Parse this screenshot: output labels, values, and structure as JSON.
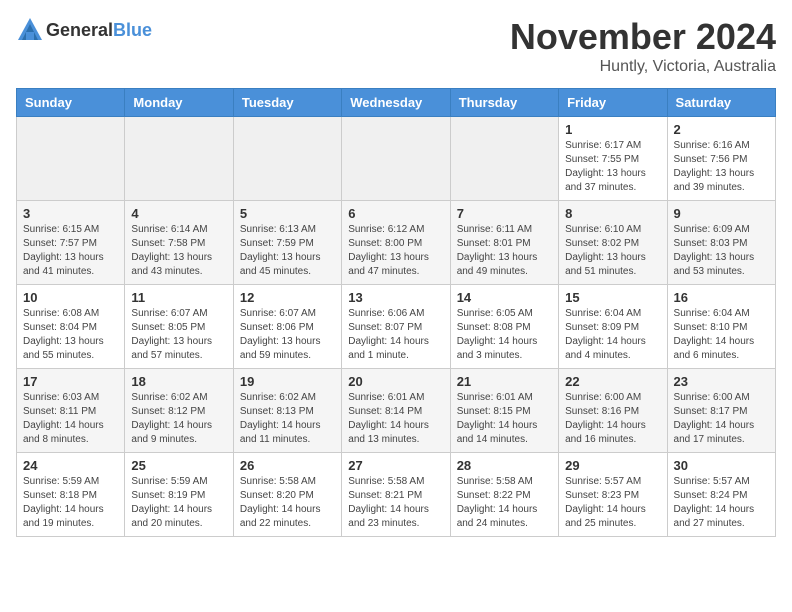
{
  "logo": {
    "general": "General",
    "blue": "Blue"
  },
  "header": {
    "month": "November 2024",
    "location": "Huntly, Victoria, Australia"
  },
  "weekdays": [
    "Sunday",
    "Monday",
    "Tuesday",
    "Wednesday",
    "Thursday",
    "Friday",
    "Saturday"
  ],
  "weeks": [
    [
      {
        "day": "",
        "info": ""
      },
      {
        "day": "",
        "info": ""
      },
      {
        "day": "",
        "info": ""
      },
      {
        "day": "",
        "info": ""
      },
      {
        "day": "",
        "info": ""
      },
      {
        "day": "1",
        "info": "Sunrise: 6:17 AM\nSunset: 7:55 PM\nDaylight: 13 hours and 37 minutes."
      },
      {
        "day": "2",
        "info": "Sunrise: 6:16 AM\nSunset: 7:56 PM\nDaylight: 13 hours and 39 minutes."
      }
    ],
    [
      {
        "day": "3",
        "info": "Sunrise: 6:15 AM\nSunset: 7:57 PM\nDaylight: 13 hours and 41 minutes."
      },
      {
        "day": "4",
        "info": "Sunrise: 6:14 AM\nSunset: 7:58 PM\nDaylight: 13 hours and 43 minutes."
      },
      {
        "day": "5",
        "info": "Sunrise: 6:13 AM\nSunset: 7:59 PM\nDaylight: 13 hours and 45 minutes."
      },
      {
        "day": "6",
        "info": "Sunrise: 6:12 AM\nSunset: 8:00 PM\nDaylight: 13 hours and 47 minutes."
      },
      {
        "day": "7",
        "info": "Sunrise: 6:11 AM\nSunset: 8:01 PM\nDaylight: 13 hours and 49 minutes."
      },
      {
        "day": "8",
        "info": "Sunrise: 6:10 AM\nSunset: 8:02 PM\nDaylight: 13 hours and 51 minutes."
      },
      {
        "day": "9",
        "info": "Sunrise: 6:09 AM\nSunset: 8:03 PM\nDaylight: 13 hours and 53 minutes."
      }
    ],
    [
      {
        "day": "10",
        "info": "Sunrise: 6:08 AM\nSunset: 8:04 PM\nDaylight: 13 hours and 55 minutes."
      },
      {
        "day": "11",
        "info": "Sunrise: 6:07 AM\nSunset: 8:05 PM\nDaylight: 13 hours and 57 minutes."
      },
      {
        "day": "12",
        "info": "Sunrise: 6:07 AM\nSunset: 8:06 PM\nDaylight: 13 hours and 59 minutes."
      },
      {
        "day": "13",
        "info": "Sunrise: 6:06 AM\nSunset: 8:07 PM\nDaylight: 14 hours and 1 minute."
      },
      {
        "day": "14",
        "info": "Sunrise: 6:05 AM\nSunset: 8:08 PM\nDaylight: 14 hours and 3 minutes."
      },
      {
        "day": "15",
        "info": "Sunrise: 6:04 AM\nSunset: 8:09 PM\nDaylight: 14 hours and 4 minutes."
      },
      {
        "day": "16",
        "info": "Sunrise: 6:04 AM\nSunset: 8:10 PM\nDaylight: 14 hours and 6 minutes."
      }
    ],
    [
      {
        "day": "17",
        "info": "Sunrise: 6:03 AM\nSunset: 8:11 PM\nDaylight: 14 hours and 8 minutes."
      },
      {
        "day": "18",
        "info": "Sunrise: 6:02 AM\nSunset: 8:12 PM\nDaylight: 14 hours and 9 minutes."
      },
      {
        "day": "19",
        "info": "Sunrise: 6:02 AM\nSunset: 8:13 PM\nDaylight: 14 hours and 11 minutes."
      },
      {
        "day": "20",
        "info": "Sunrise: 6:01 AM\nSunset: 8:14 PM\nDaylight: 14 hours and 13 minutes."
      },
      {
        "day": "21",
        "info": "Sunrise: 6:01 AM\nSunset: 8:15 PM\nDaylight: 14 hours and 14 minutes."
      },
      {
        "day": "22",
        "info": "Sunrise: 6:00 AM\nSunset: 8:16 PM\nDaylight: 14 hours and 16 minutes."
      },
      {
        "day": "23",
        "info": "Sunrise: 6:00 AM\nSunset: 8:17 PM\nDaylight: 14 hours and 17 minutes."
      }
    ],
    [
      {
        "day": "24",
        "info": "Sunrise: 5:59 AM\nSunset: 8:18 PM\nDaylight: 14 hours and 19 minutes."
      },
      {
        "day": "25",
        "info": "Sunrise: 5:59 AM\nSunset: 8:19 PM\nDaylight: 14 hours and 20 minutes."
      },
      {
        "day": "26",
        "info": "Sunrise: 5:58 AM\nSunset: 8:20 PM\nDaylight: 14 hours and 22 minutes."
      },
      {
        "day": "27",
        "info": "Sunrise: 5:58 AM\nSunset: 8:21 PM\nDaylight: 14 hours and 23 minutes."
      },
      {
        "day": "28",
        "info": "Sunrise: 5:58 AM\nSunset: 8:22 PM\nDaylight: 14 hours and 24 minutes."
      },
      {
        "day": "29",
        "info": "Sunrise: 5:57 AM\nSunset: 8:23 PM\nDaylight: 14 hours and 25 minutes."
      },
      {
        "day": "30",
        "info": "Sunrise: 5:57 AM\nSunset: 8:24 PM\nDaylight: 14 hours and 27 minutes."
      }
    ]
  ]
}
